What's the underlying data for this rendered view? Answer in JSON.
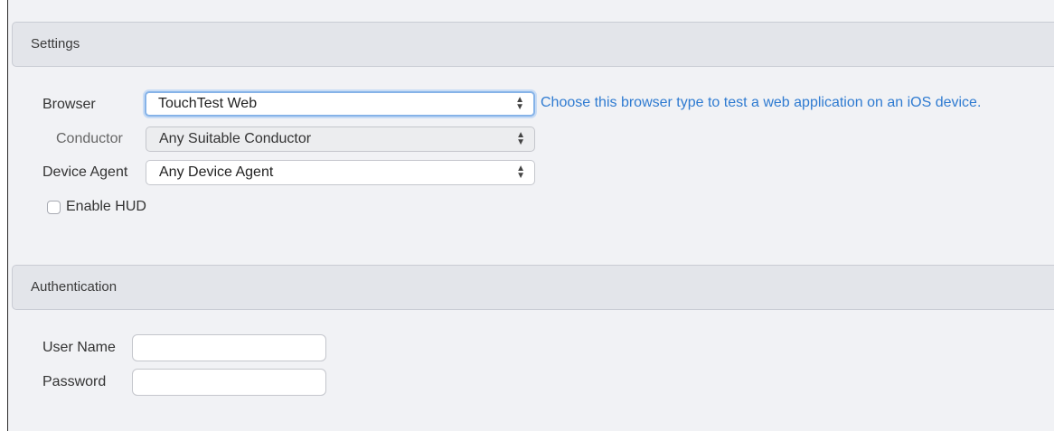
{
  "settings": {
    "title": "Settings",
    "browser": {
      "label": "Browser",
      "value": "TouchTest Web",
      "hint": "Choose this browser type to test a web application on an iOS device."
    },
    "conductor": {
      "label": "Conductor",
      "value": "Any Suitable Conductor"
    },
    "device_agent": {
      "label": "Device Agent",
      "value": "Any Device Agent"
    },
    "enable_hud": {
      "label": "Enable HUD",
      "checked": false
    }
  },
  "authentication": {
    "title": "Authentication",
    "user_name": {
      "label": "User Name",
      "value": ""
    },
    "password": {
      "label": "Password",
      "value": ""
    }
  },
  "colors": {
    "hint_link": "#2f7bd1",
    "focus_ring": "#86b3e8",
    "header_bg": "#e3e5ea",
    "panel_bg": "#f1f2f5"
  }
}
